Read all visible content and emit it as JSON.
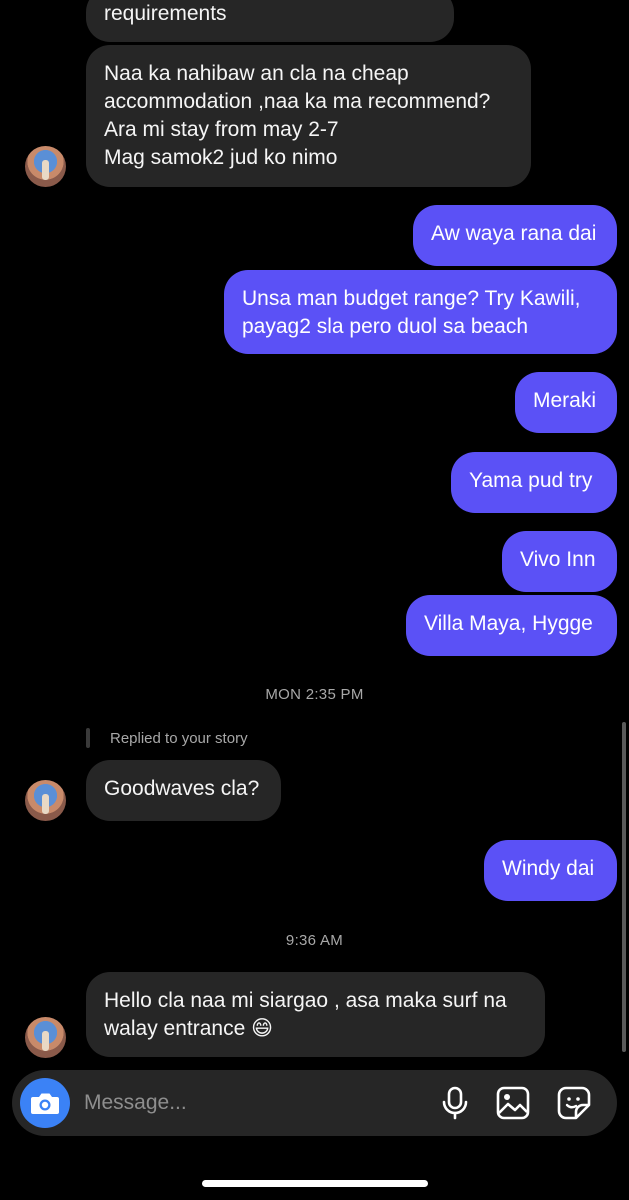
{
  "conversation": {
    "partial_top": "requirements",
    "msg1_lines": [
      "Naa ka nahibaw an cla na cheap",
      "accommodation ,naa ka ma recommend?",
      "Ara mi stay from may 2-7",
      "Mag samok2 jud ko nimo"
    ],
    "out1": "Aw waya rana dai",
    "out2_lines": [
      "Unsa man budget range? Try Kawili,",
      "payag2 sla pero duol sa beach"
    ],
    "out3": "Meraki",
    "out4": "Yama pud try",
    "out5": "Vivo Inn",
    "out6": "Villa Maya, Hygge",
    "timestamp1": "MON 2:35 PM",
    "reply_label": "Replied to your story",
    "in2": "Goodwaves cla?",
    "out7": "Windy dai",
    "timestamp2": "9:36 AM",
    "in3_lines": [
      "Hello cla naa mi siargao , asa maka surf na",
      "walay entrance 😄"
    ]
  },
  "composer": {
    "placeholder": "Message..."
  },
  "icons": [
    "camera-icon",
    "microphone-icon",
    "gallery-icon",
    "sticker-icon"
  ],
  "colors": {
    "outgoing": "#5b51f6",
    "incoming": "#262626",
    "camera_button": "#3b82f6"
  }
}
